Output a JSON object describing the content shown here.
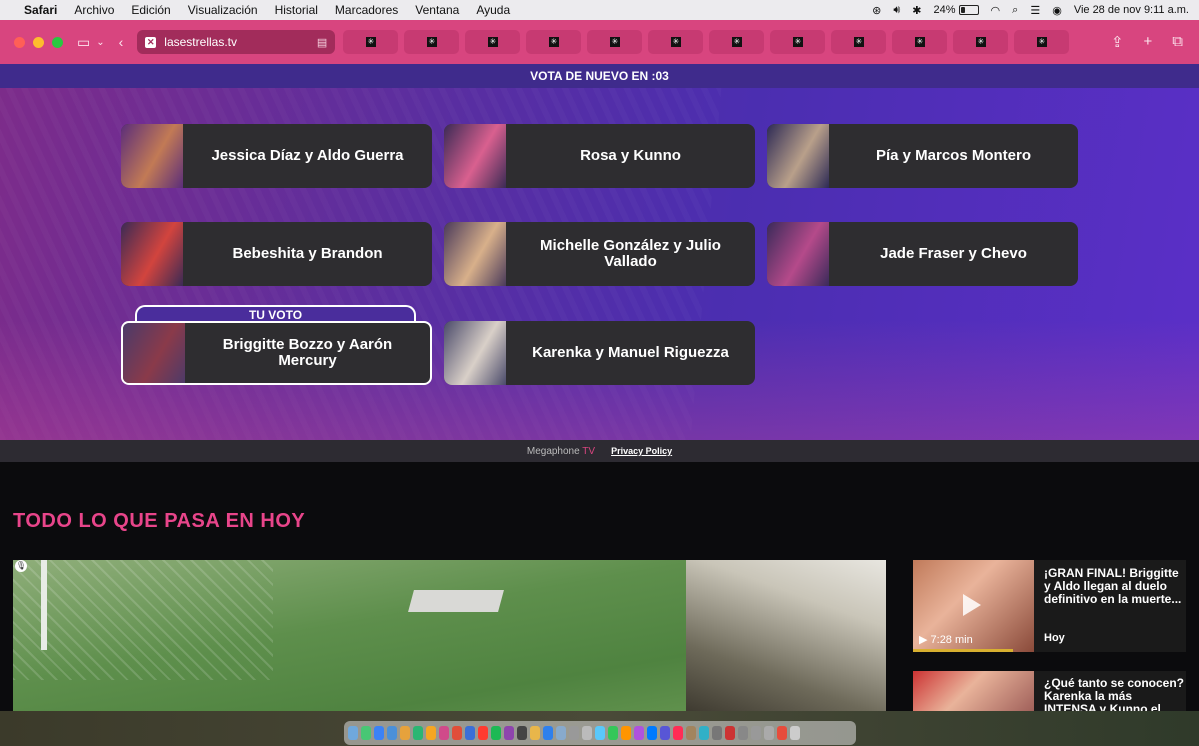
{
  "menubar": {
    "app": "Safari",
    "items": [
      "Archivo",
      "Edición",
      "Visualización",
      "Historial",
      "Marcadores",
      "Ventana",
      "Ayuda"
    ],
    "battery": "24%",
    "battery_level": 0.24,
    "datetime": "Vie 28 de nov  9:11 a.m."
  },
  "browser": {
    "url": "lasestrellas.tv",
    "tab_count": 12
  },
  "vote": {
    "countdown": "VOTA DE NUEVO EN :03",
    "your_vote_label": "TU VOTO",
    "options": [
      {
        "name": "Jessica Díaz y Aldo Guerra"
      },
      {
        "name": "Rosa y Kunno"
      },
      {
        "name": "Pía y Marcos Montero"
      },
      {
        "name": "Bebeshita y Brandon"
      },
      {
        "name": "Michelle González y Julio Vallado"
      },
      {
        "name": "Jade Fraser y Chevo"
      },
      {
        "name": "Briggitte Bozzo y Aarón Mercury",
        "selected": true
      },
      {
        "name": "Karenka y Manuel Riguezza"
      }
    ],
    "footer_brand": "Megaphone",
    "footer_brand_tv": "TV",
    "footer_policy": "Privacy Policy"
  },
  "section": {
    "title": "TODO LO QUE PASA EN HOY"
  },
  "sidebar": {
    "items": [
      {
        "title": "¡GRAN FINAL! Briggitte y Aldo llegan al duelo definitivo en la muerte...",
        "duration": "7:28 min",
        "label": "Hoy"
      },
      {
        "title": "¿Qué tanto se conocen? Karenka la más INTENSA y Kunno el m...",
        "duration": "",
        "label": ""
      }
    ]
  },
  "colors": {
    "accent": "#d8457f",
    "title_pink": "#e8458a"
  }
}
